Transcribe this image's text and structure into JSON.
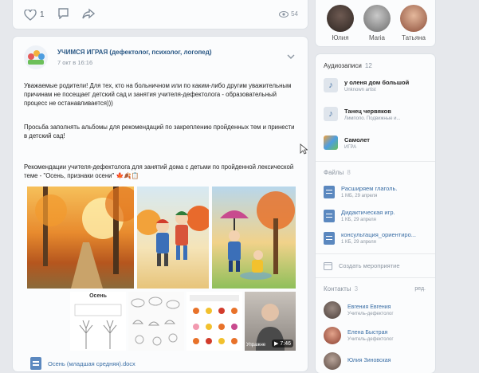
{
  "top_post": {
    "likes": "1",
    "views": "54"
  },
  "friends": [
    {
      "name": "Юлия"
    },
    {
      "name": "Maria"
    },
    {
      "name": "Татьяна"
    }
  ],
  "post": {
    "author": "УЧИМСЯ ИГРАЯ (дефектолог, психолог, логопед)",
    "date": "7 окт в 16:16",
    "paragraphs": [
      "Уважаемые родители! Для тех, кто на больничном или по каким-либо другим уважительным причинам не посещает детский сад и занятия учителя-дефектолога - образовательный процесс не останавливается)))",
      "Просьба заполнять альбомы для рекомендаций по закреплению пройденных тем и принести в детский сад!",
      "Рекомендации учителя-дефектолога для занятий дома с детьми по пройденной лексической теме - \"Осень, признаки осени\" 🍁🍂📋"
    ],
    "worksheet_title": "Осень",
    "video_caption": "Упражне",
    "video_duration": "7:46",
    "attachment": "Осень (младшая средняя).docx"
  },
  "audio": {
    "title": "Аудиозаписи",
    "count": "12",
    "tracks": [
      {
        "title": "у оленя дом большой",
        "artist": "Unknown artist"
      },
      {
        "title": "Танец червяков",
        "artist": "Лимпопо. Подвижные и..."
      },
      {
        "title": "Самолет",
        "artist": "ИГРА"
      }
    ]
  },
  "files": {
    "title": "Файлы",
    "count": "8",
    "items": [
      {
        "name": "Расширяем глаголь.",
        "meta": "1 МБ, 29 апреля"
      },
      {
        "name": "Дидактическая игр.",
        "meta": "1 КБ, 29 апреля"
      },
      {
        "name": "консультация_ориентиро...",
        "meta": "1 КБ, 29 апреля"
      }
    ]
  },
  "create_event": "Создать мероприятие",
  "contacts": {
    "title": "Контакты",
    "count": "3",
    "edit": "ред.",
    "items": [
      {
        "name": "Евгения Евгения",
        "role": "Учитель-дефектолог"
      },
      {
        "name": "Елена Быстрая",
        "role": "Учитель-дефектолог"
      },
      {
        "name": "Юлия Зиновская",
        "role": ""
      }
    ]
  }
}
